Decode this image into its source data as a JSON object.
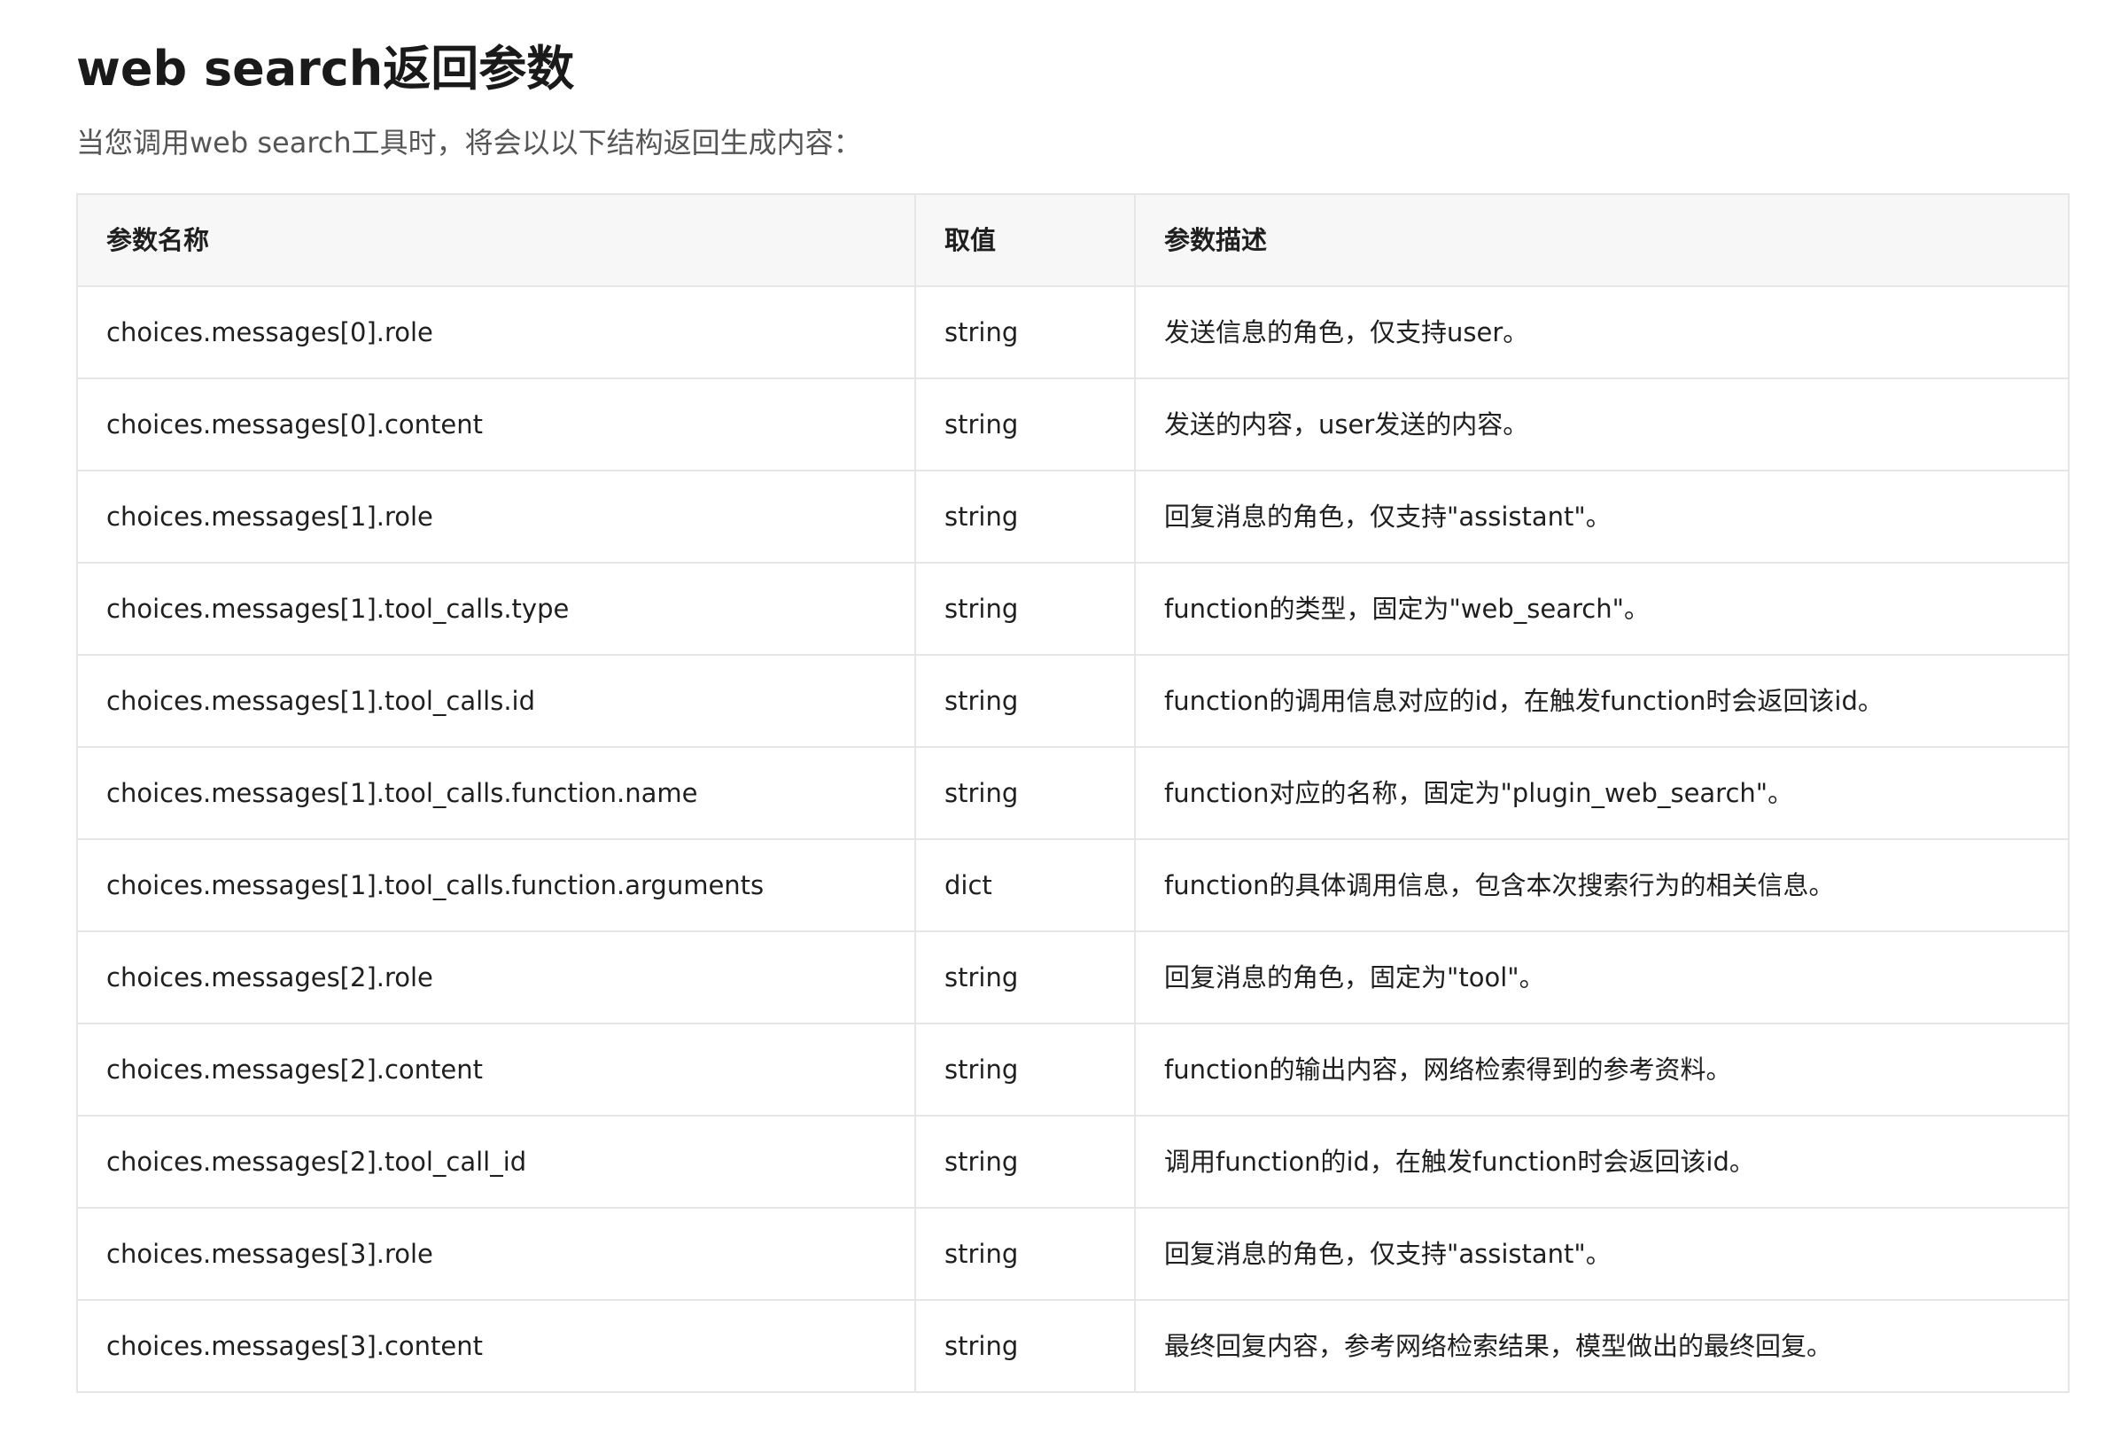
{
  "title": "web search返回参数",
  "intro": "当您调用web search工具时，将会以以下结构返回生成内容：",
  "table": {
    "headers": [
      "参数名称",
      "取值",
      "参数描述"
    ],
    "rows": [
      {
        "name": "choices.messages[0].role",
        "value": "string",
        "desc": "发送信息的角色，仅支持user。"
      },
      {
        "name": "choices.messages[0].content",
        "value": "string",
        "desc": "发送的内容，user发送的内容。"
      },
      {
        "name": "choices.messages[1].role",
        "value": "string",
        "desc": "回复消息的角色，仅支持\"assistant\"。"
      },
      {
        "name": "choices.messages[1].tool_calls.type",
        "value": "string",
        "desc": "function的类型，固定为\"web_search\"。"
      },
      {
        "name": "choices.messages[1].tool_calls.id",
        "value": "string",
        "desc": "function的调用信息对应的id，在触发function时会返回该id。"
      },
      {
        "name": "choices.messages[1].tool_calls.function.name",
        "value": "string",
        "desc": "function对应的名称，固定为\"plugin_web_search\"。"
      },
      {
        "name": "choices.messages[1].tool_calls.function.arguments",
        "value": "dict",
        "desc": "function的具体调用信息，包含本次搜索行为的相关信息。"
      },
      {
        "name": "choices.messages[2].role",
        "value": "string",
        "desc": "回复消息的角色，固定为\"tool\"。"
      },
      {
        "name": "choices.messages[2].content",
        "value": "string",
        "desc": "function的输出内容，网络检索得到的参考资料。"
      },
      {
        "name": "choices.messages[2].tool_call_id",
        "value": "string",
        "desc": "调用function的id，在触发function时会返回该id。"
      },
      {
        "name": "choices.messages[3].role",
        "value": "string",
        "desc": "回复消息的角色，仅支持\"assistant\"。"
      },
      {
        "name": "choices.messages[3].content",
        "value": "string",
        "desc": "最终回复内容，参考网络检索结果，模型做出的最终回复。"
      }
    ]
  }
}
